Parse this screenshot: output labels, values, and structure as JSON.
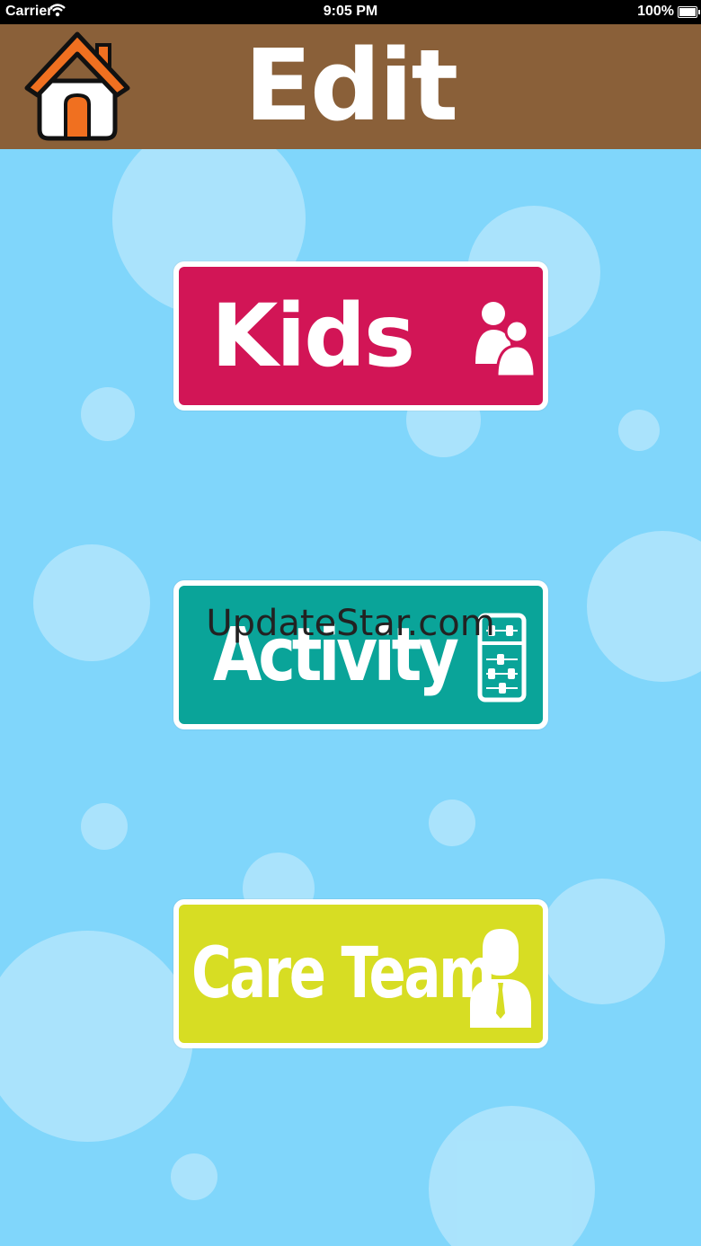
{
  "status_bar": {
    "carrier": "Carrier",
    "time": "9:05 PM",
    "battery": "100%"
  },
  "header": {
    "title": "Edit",
    "home_icon": "home-icon"
  },
  "menu": {
    "kids": {
      "label": "Kids",
      "icon": "kids-icon",
      "color": "#d21556"
    },
    "activity": {
      "label": "Activity",
      "icon": "abacus-icon",
      "color": "#0aa499"
    },
    "care_team": {
      "label": "Care Team",
      "icon": "person-icon",
      "color": "#d7dd23"
    }
  },
  "watermark": "UpdateStar.com",
  "colors": {
    "header_bg": "#8a6039",
    "main_bg": "#80d6fb",
    "home_roof": "#f07020"
  }
}
